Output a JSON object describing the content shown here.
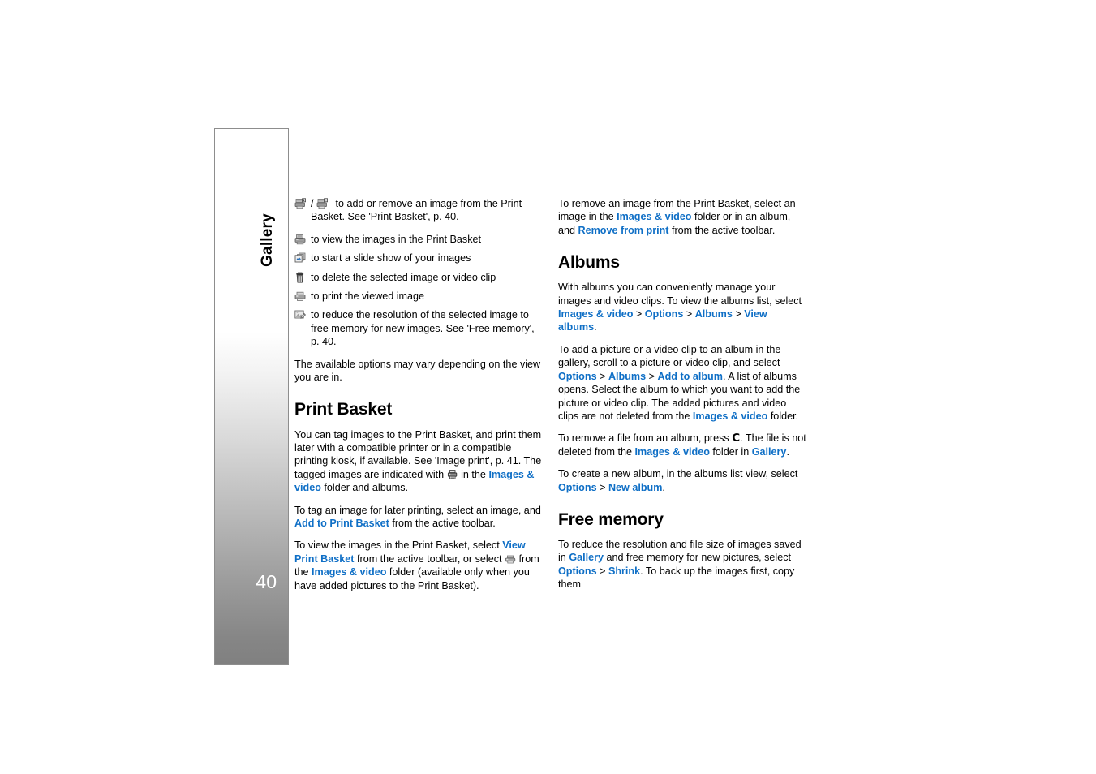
{
  "page": {
    "number": "40",
    "chapter_tab_label": "Gallery",
    "background": "#ffffff",
    "link_color": "#0f6fc6"
  },
  "left_column": {
    "toolbar_icons": [
      {
        "icon": "print-basket-add-remove-icon",
        "icon_secondary": "print-basket-remove-icon",
        "separator": "/",
        "text_a": "to add or remove an image from the Print Basket.",
        "text_b": "See 'Print Basket', p. 40."
      },
      {
        "icon": "view-print-basket-icon",
        "text": "to view the images in the Print Basket"
      },
      {
        "icon": "slide-show-icon",
        "text": "to start a slide show of your images"
      },
      {
        "icon": "delete-trash-icon",
        "text": "to delete the selected image or video clip"
      },
      {
        "icon": "print-icon",
        "text": "to print the viewed image"
      },
      {
        "icon": "shrink-resolution-icon",
        "text_a": "to reduce the resolution of the selected image to free",
        "text_b": "memory for new images. See 'Free memory', p. 40."
      }
    ],
    "note": "The available options may vary depending on the view you are in.",
    "heading": "Print Basket",
    "para_1_seg_1": "You can tag images to the Print Basket, and print them later with a compatible printer or in a compatible printing kiosk, if available. See 'Image print', p. 41. The tagged images are indicated with",
    "para_1_seg_2": "in the",
    "para_1_link": "Images & video",
    "para_1_seg_3": "folder and albums.",
    "para_2_seg_1": "To tag an image for later printing, select an image, and",
    "para_2_link": "Add to Print Basket",
    "para_2_seg_2": "from the active toolbar.",
    "para_3_seg_1": "To view the images in the Print Basket, select",
    "para_3_link_1": "View Print Basket",
    "para_3_seg_2": "from the active toolbar, or select",
    "para_3_seg_3": "from the",
    "para_3_link_2": "Images & video",
    "para_3_seg_4": "folder (available only when you have added pictures to the Print Basket)."
  },
  "right_column": {
    "para_1_seg_1": "To remove an image from the Print Basket, select an image in the",
    "para_1_link_1": "Images & video",
    "para_1_seg_2": "folder or in an album, and",
    "para_1_link_2": "Remove from print",
    "para_1_seg_3": "from the active toolbar.",
    "albums_heading": "Albums",
    "albums_para_1_seg_1": "With albums you can conveniently manage your images and video clips. To view the albums list, select",
    "albums_para_1_link_1": "Images & video",
    "albums_para_1_link_2": "Options",
    "albums_para_1_link_3": "Albums",
    "albums_para_1_link_4": "View albums",
    "albums_para_1_end": ".",
    "albums_para_2_seg_1": "To add a picture or a video clip to an album in the gallery, scroll to a picture or video clip, and select",
    "albums_para_2_link_1": "Options",
    "albums_para_2_link_2": "Albums",
    "albums_para_2_link_3": "Add to album",
    "albums_para_2_seg_2": ". A list of albums opens. Select the album to which you want to add the picture or video clip. The added pictures and video clips are not deleted from the",
    "albums_para_2_link_4": "Images & video",
    "albums_para_2_seg_3": "folder.",
    "albums_para_3_seg_1": "To remove a file from an album, press",
    "albums_para_3_key": "C",
    "albums_para_3_seg_2": ". The file is not deleted from the",
    "albums_para_3_link_1": "Images & video",
    "albums_para_3_seg_3": "folder in",
    "albums_para_3_link_2": "Gallery",
    "albums_para_3_seg_4": ".",
    "albums_para_4_seg_1": "To create a new album, in the albums list view, select",
    "albums_para_4_link_1": "Options",
    "albums_para_4_link_2": "New album",
    "albums_para_4_seg_2": ".",
    "freemem_heading": "Free memory",
    "freemem_para_seg_1": "To reduce the resolution and file size of images saved in",
    "freemem_link_1": "Gallery",
    "freemem_para_seg_2": "and free memory for new pictures, select",
    "freemem_link_2": "Options",
    "freemem_link_3": "Shrink",
    "freemem_para_seg_3": ". To back up the images first, copy them"
  },
  "symbols": {
    "gt": ">",
    "slash": "/",
    "ampersand": "&"
  }
}
